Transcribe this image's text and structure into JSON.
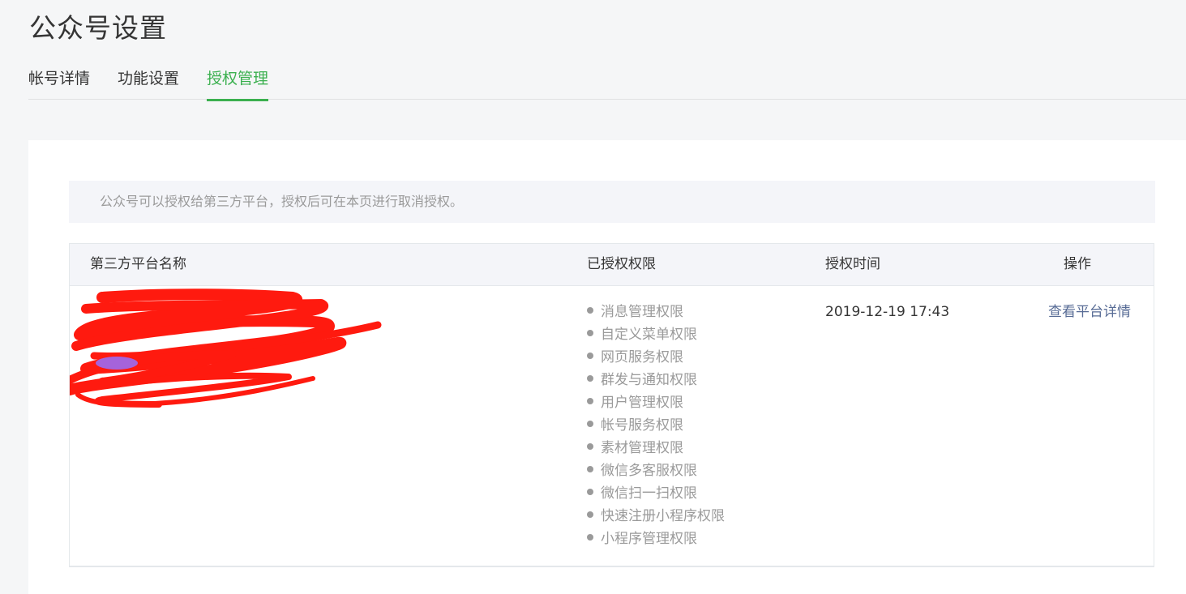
{
  "header": {
    "title": "公众号设置"
  },
  "tabs": [
    {
      "label": "帐号详情",
      "active": false
    },
    {
      "label": "功能设置",
      "active": false
    },
    {
      "label": "授权管理",
      "active": true
    }
  ],
  "notice": {
    "text": "公众号可以授权给第三方平台，授权后可在本页进行取消授权。"
  },
  "table": {
    "columns": [
      "第三方平台名称",
      "已授权权限",
      "授权时间",
      "操作"
    ],
    "rows": [
      {
        "name": "",
        "permissions": [
          "消息管理权限",
          "自定义菜单权限",
          "网页服务权限",
          "群发与通知权限",
          "用户管理权限",
          "帐号服务权限",
          "素材管理权限",
          "微信多客服权限",
          "微信扫一扫权限",
          "快速注册小程序权限",
          "小程序管理权限"
        ],
        "time": "2019-12-19 17:43",
        "action": "查看平台详情"
      }
    ]
  },
  "colors": {
    "accent": "#3bb04f",
    "link": "#576b95",
    "muted": "#9a9a9a",
    "redaction": "#ff1a0f"
  },
  "icons": {
    "bullet": "dot"
  }
}
